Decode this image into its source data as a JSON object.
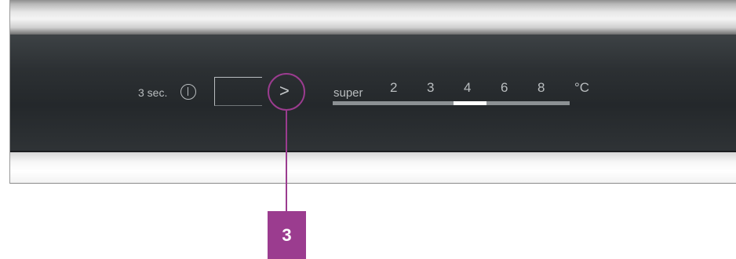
{
  "control_panel": {
    "hold_hint": "3 sec.",
    "power_icon": "power-icon",
    "next_arrow": ">",
    "temperature": {
      "super_label": "super",
      "settings": [
        "2",
        "3",
        "4",
        "6",
        "8"
      ],
      "unit": "°C",
      "selected": "4"
    }
  },
  "callout": {
    "number": "3",
    "color": "#9b3c8f"
  }
}
